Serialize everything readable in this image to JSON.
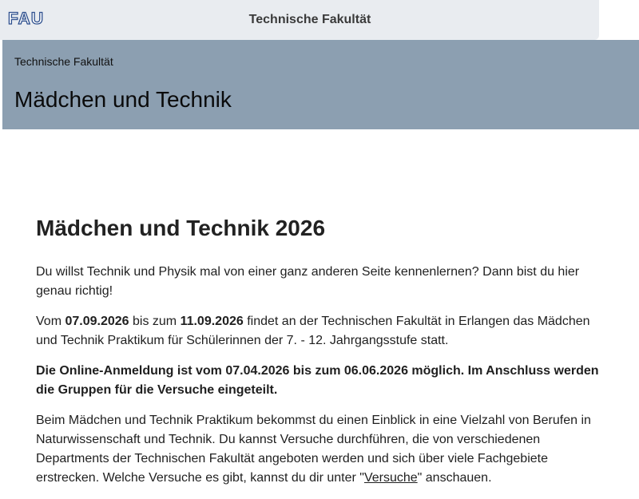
{
  "header": {
    "logo_text": "FAU",
    "faculty_title": "Technische Fakultät"
  },
  "hero": {
    "breadcrumb": "Technische Fakultät",
    "title": "Mädchen und Technik"
  },
  "main": {
    "heading": "Mädchen und Technik 2026",
    "intro": "Du willst Technik und Physik mal von einer ganz anderen Seite kennenlernen? Dann bist du hier genau richtig!",
    "dates": {
      "prefix": "Vom ",
      "start": "07.09.2026",
      "middle": " bis zum ",
      "end": "11.09.2026",
      "suffix": "  findet an der Technischen Fakultät in Erlangen das Mädchen und Technik Praktikum für Schülerinnen der 7. - 12. Jahrgangsstufe statt."
    },
    "registration": "Die Online-Anmeldung ist vom 07.04.2026 bis zum 06.06.2026 möglich. Im Anschluss werden die Gruppen für die Versuche eingeteilt.",
    "description": {
      "text": "Beim Mädchen und Technik Praktikum bekommst du einen Einblick in eine Vielzahl von Berufen in Naturwissenschaft und Technik. Du kannst Versuche durchführen, die von verschiedenen Departments der Technischen Fakultät angeboten werden und sich über viele Fachgebiete erstrecken. Welche Versuche es gibt, kannst du dir unter \"",
      "link": "Versuche",
      "tail": "\" anschauen."
    }
  }
}
